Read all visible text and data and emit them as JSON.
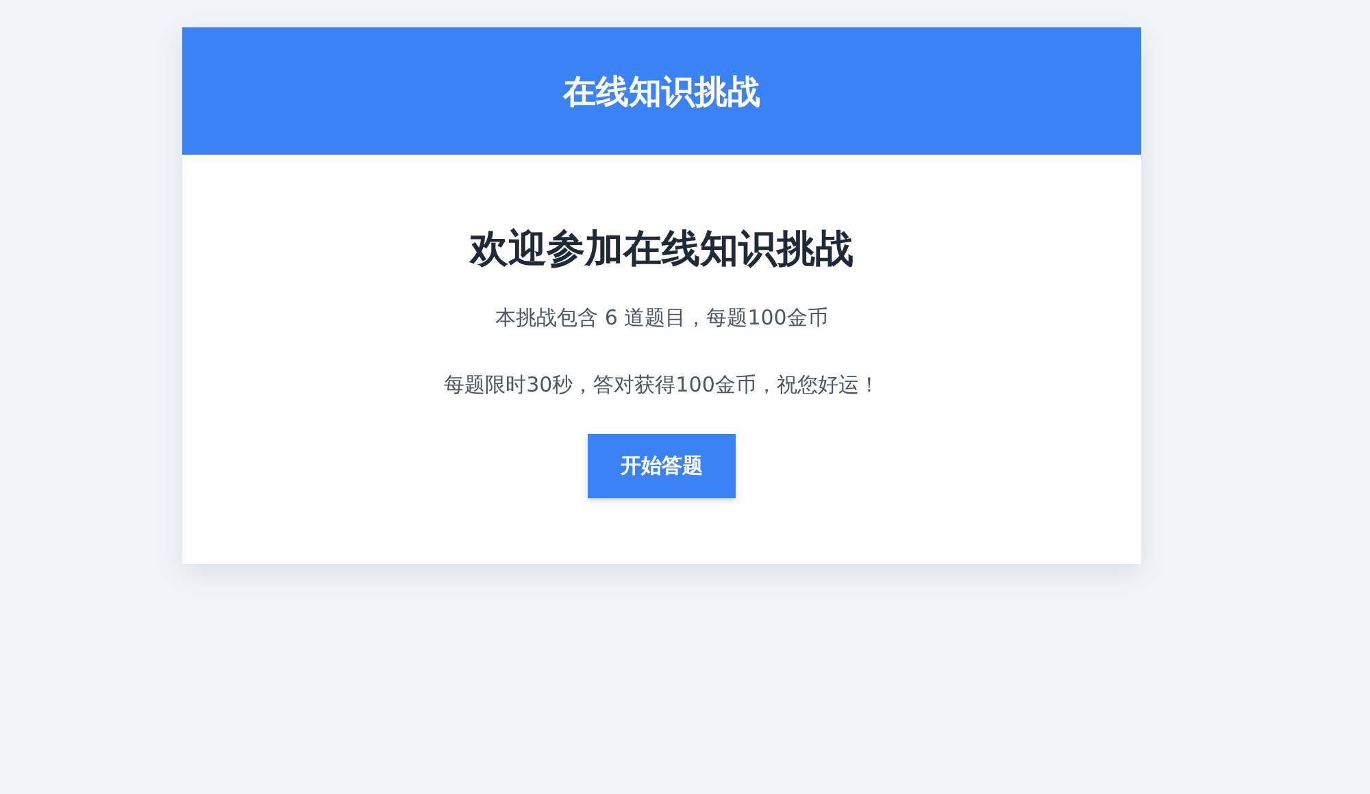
{
  "header": {
    "title": "在线知识挑战"
  },
  "welcome": {
    "heading": "欢迎参加在线知识挑战",
    "lines": [
      "本挑战包含 6 道题目，每题100金币",
      "每题限时30秒，答对获得100金币，祝您好运！"
    ],
    "start_button": "开始答题"
  }
}
